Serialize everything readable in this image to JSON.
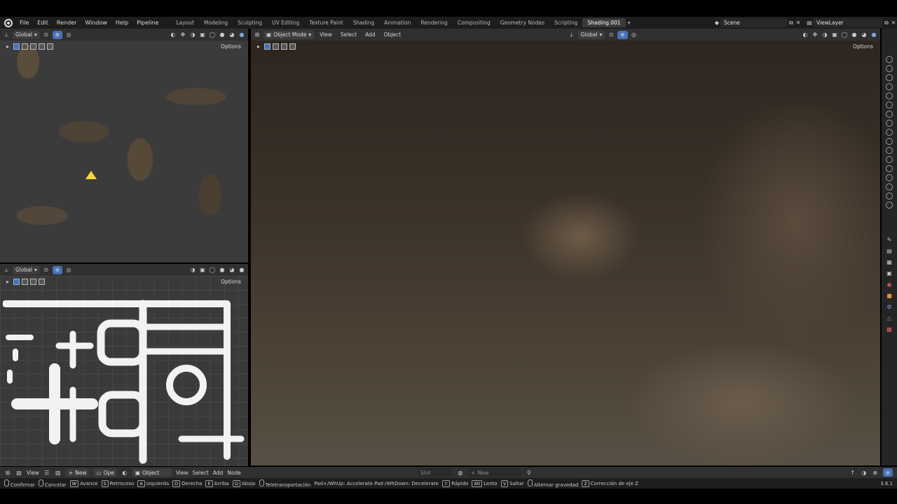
{
  "menu": [
    "File",
    "Edit",
    "Render",
    "Window",
    "Help",
    "Pipeline"
  ],
  "workspaces": [
    "Layout",
    "Modeling",
    "Sculpting",
    "UV Editing",
    "Texture Paint",
    "Shading",
    "Animation",
    "Rendering",
    "Compositing",
    "Geometry Nodes",
    "Scripting",
    "Shading.001"
  ],
  "active_workspace": "Shading.001",
  "scene": "Scene",
  "view_layer": "ViewLayer",
  "viewport_tl": {
    "orientation": "Global",
    "options": "Options"
  },
  "viewport_bl": {
    "orientation": "Global",
    "options": "Options"
  },
  "viewport_main": {
    "mode": "Object Mode",
    "menu": [
      "View",
      "Select",
      "Add",
      "Object"
    ],
    "orientation": "Global",
    "options": "Options"
  },
  "node_editor": {
    "view": "View",
    "new_label": "New",
    "open_label": "Ope",
    "object": "Object",
    "menu": [
      "View",
      "Select",
      "Add",
      "Node"
    ],
    "slot": "Slot",
    "new2": "New"
  },
  "status": {
    "items": [
      {
        "key": "",
        "label": "Confirmar",
        "mouse": true
      },
      {
        "key": "",
        "label": "Cancelar",
        "mouse": true
      },
      {
        "key": "W",
        "label": "Avance"
      },
      {
        "key": "S",
        "label": "Retroceso"
      },
      {
        "key": "A",
        "label": "Izquierda"
      },
      {
        "key": "D",
        "label": "Derecha"
      },
      {
        "key": "E",
        "label": "Arriba"
      },
      {
        "key": "Q",
        "label": "Abajo"
      },
      {
        "key": "",
        "label": "Teletransportación",
        "mouse": true
      },
      {
        "key": "",
        "label": "Pad+/WhUp: Accelerate Pad-/WhDown: Decelerate"
      },
      {
        "key": "⇧",
        "label": "Rápido"
      },
      {
        "key": "Alt",
        "label": "Lento"
      },
      {
        "key": "V",
        "label": "Saltar"
      },
      {
        "key": "",
        "label": "Alternar gravedad",
        "mouse": true
      },
      {
        "key": "Z",
        "label": "Corrección de eje Z"
      }
    ],
    "version": "3.6.1"
  }
}
